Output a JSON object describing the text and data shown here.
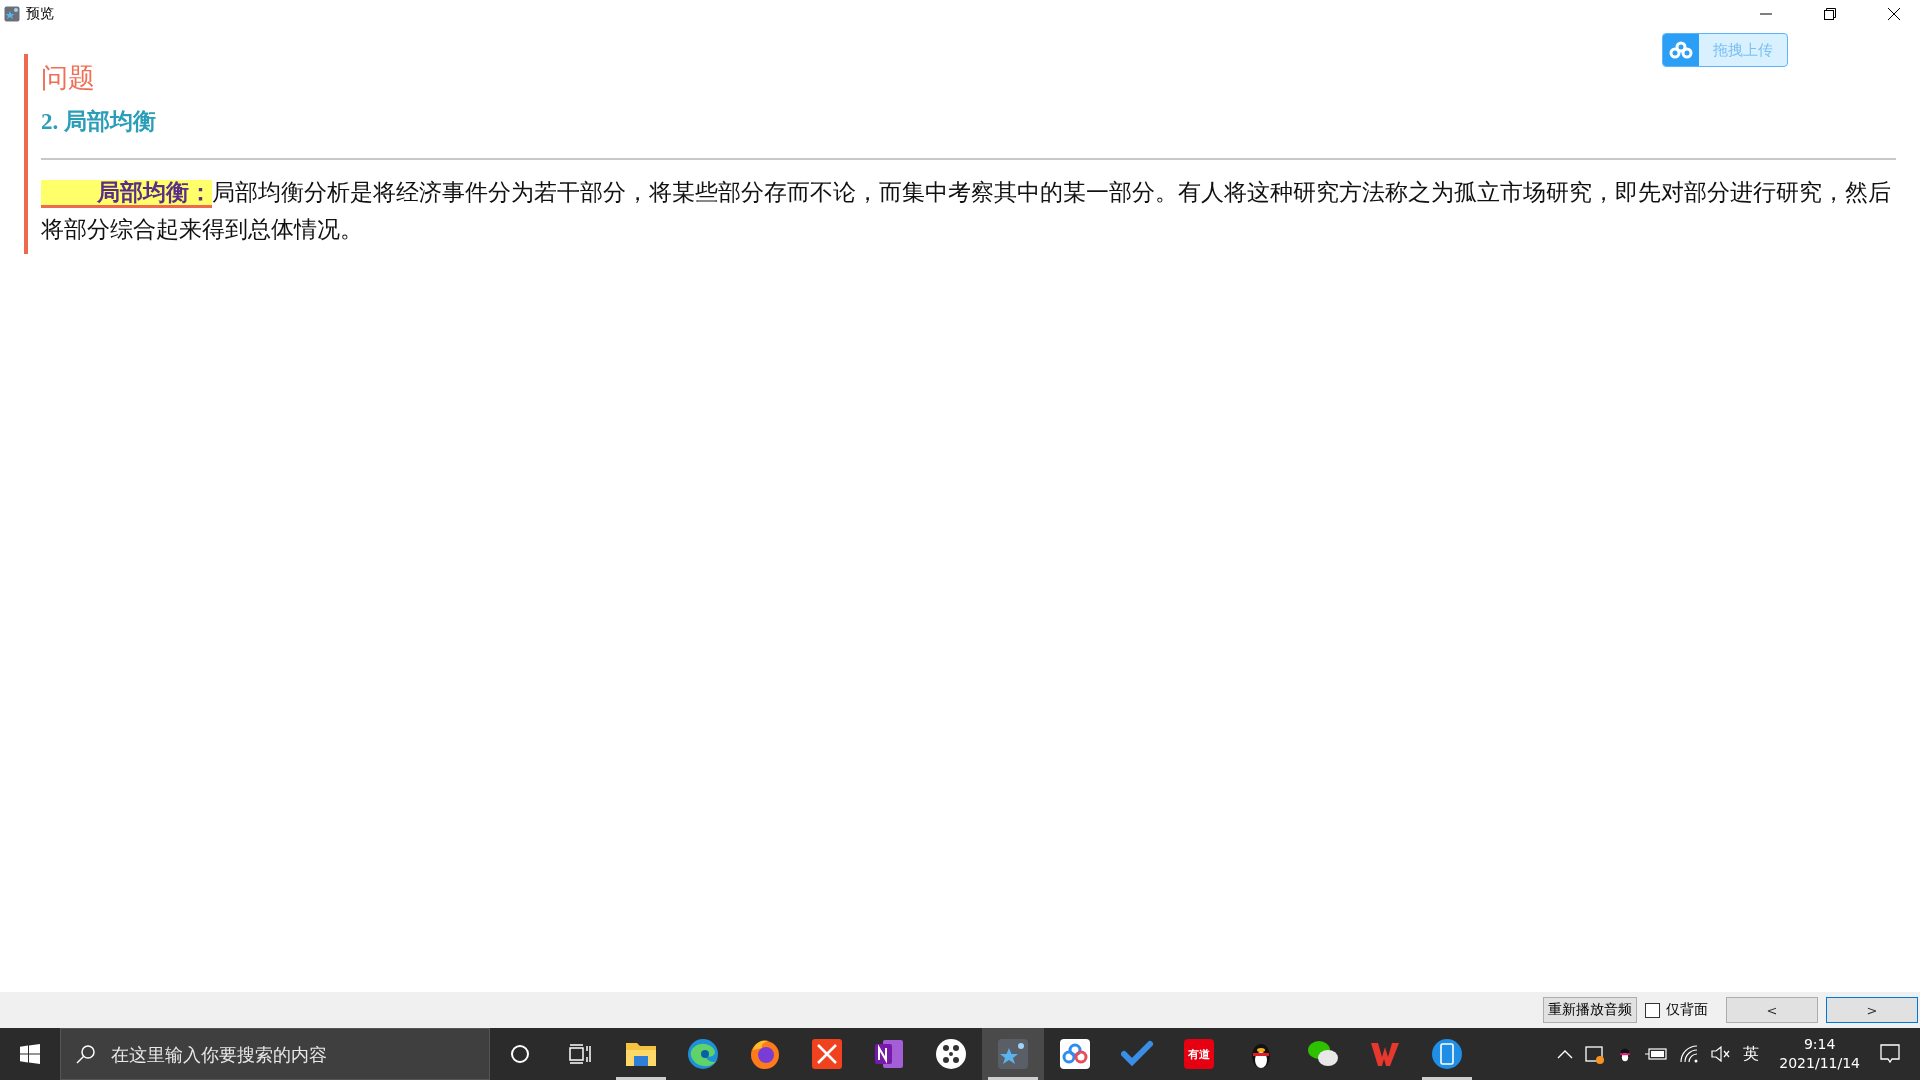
{
  "window": {
    "title": "预览"
  },
  "upload_button": {
    "label": "拖拽上传"
  },
  "card": {
    "heading": "问题",
    "subheading": "2. 局部均衡",
    "term": "局部均衡：",
    "text": "局部均衡分析是将经济事件分为若干部分，将某些部分存而不论，而集中考察其中的某一部分。有人将这种研究方法称之为孤立市场研究，即先对部分进行研究，然后将部分综合起来得到总体情况。"
  },
  "bottom_bar": {
    "replay_button": "重新播放音频",
    "back_only": {
      "label": "仅背面",
      "checked": false
    },
    "nav_buttons": [
      {
        "label": "<",
        "focused": false
      },
      {
        "label": ">",
        "focused": true
      }
    ]
  },
  "taskbar": {
    "search": {
      "placeholder": "在这里输入你要搜索的内容"
    },
    "apps": [
      {
        "kind": "explorer",
        "running": true,
        "active": false
      },
      {
        "kind": "edge",
        "running": false,
        "active": false
      },
      {
        "kind": "firefox",
        "running": false,
        "active": false
      },
      {
        "kind": "xmind",
        "running": false,
        "active": false
      },
      {
        "kind": "onenote",
        "running": false,
        "active": false
      },
      {
        "kind": "dots",
        "running": false,
        "active": false
      },
      {
        "kind": "preview",
        "running": true,
        "active": true
      },
      {
        "kind": "cloud",
        "running": false,
        "active": false
      },
      {
        "kind": "todo",
        "running": false,
        "active": false
      },
      {
        "kind": "youdao",
        "running": false,
        "active": false,
        "label": "有道"
      },
      {
        "kind": "penguin",
        "running": false,
        "active": false
      },
      {
        "kind": "chat",
        "running": false,
        "active": false
      },
      {
        "kind": "wps",
        "running": false,
        "active": false
      },
      {
        "kind": "phone",
        "running": true,
        "active": false
      }
    ],
    "tray": {
      "language": "英",
      "time": "9:14",
      "date": "2021/11/14"
    }
  }
}
